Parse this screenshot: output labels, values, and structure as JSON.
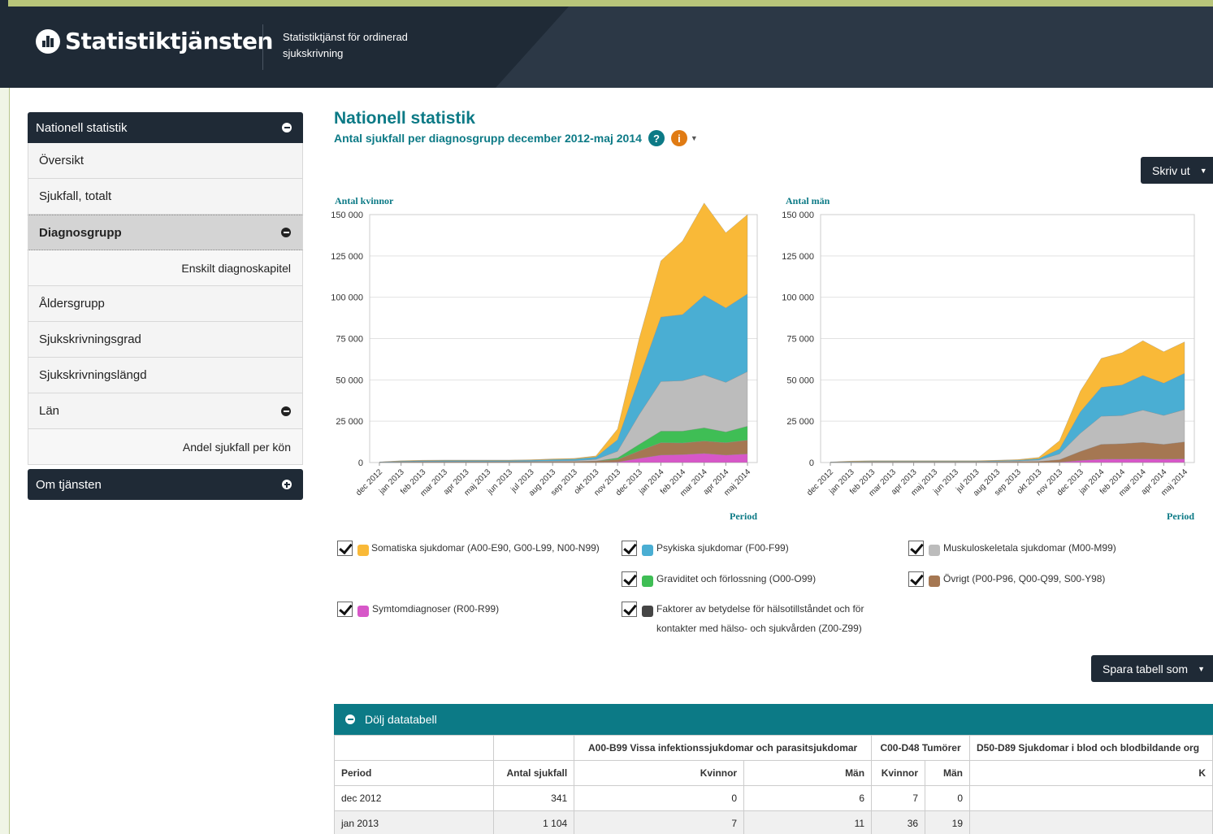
{
  "header": {
    "logo_text": "Statistiktjänsten",
    "subtitle": "Statistiktjänst för ordinerad sjukskrivning"
  },
  "sidebar": {
    "section_title": "Nationell statistik",
    "items": [
      {
        "label": "Översikt"
      },
      {
        "label": "Sjukfall, totalt"
      },
      {
        "label": "Diagnosgrupp"
      },
      {
        "label": "Enskilt diagnoskapitel"
      },
      {
        "label": "Åldersgrupp"
      },
      {
        "label": "Sjukskrivningsgrad"
      },
      {
        "label": "Sjukskrivningslängd"
      },
      {
        "label": "Län"
      },
      {
        "label": "Andel sjukfall per kön"
      }
    ],
    "about_title": "Om tjänsten"
  },
  "main": {
    "title": "Nationell statistik",
    "subtitle": "Antal sjukfall per diagnosgrupp december 2012-maj 2014",
    "print_label": "Skriv ut",
    "save_label": "Spara tabell som"
  },
  "legend": [
    {
      "label": "Somatiska sjukdomar (A00-E90, G00-L99, N00-N99)",
      "color": "#f9b938"
    },
    {
      "label": "Psykiska sjukdomar (F00-F99)",
      "color": "#4aaed3"
    },
    {
      "label": "Muskuloskeletala sjukdomar (M00-M99)",
      "color": "#bcbcbc"
    },
    {
      "label": "Graviditet och förlossning (O00-O99)",
      "color": "#3fbe55"
    },
    {
      "label": "Övrigt (P00-P96, Q00-Q99, S00-Y98)",
      "color": "#a57752"
    },
    {
      "label": "Symtomdiagnoser (R00-R99)",
      "color": "#d757c8"
    },
    {
      "label": "Faktorer av betydelse för hälsotillståndet och för kontakter med hälso- och sjukvården (Z00-Z99)",
      "color": "#454545"
    }
  ],
  "chart_data": [
    {
      "type": "area",
      "title": "Antal kvinnor",
      "xlabel": "Period",
      "ylim": [
        0,
        150000
      ],
      "yticks": [
        "0",
        "25 000",
        "50 000",
        "75 000",
        "100 000",
        "125 000",
        "150 000"
      ],
      "categories": [
        "dec 2012",
        "jan 2013",
        "feb 2013",
        "mar 2013",
        "apr 2013",
        "maj 2013",
        "jun 2013",
        "jul 2013",
        "aug 2013",
        "sep 2013",
        "okt 2013",
        "nov 2013",
        "dec 2013",
        "jan 2014",
        "feb 2014",
        "mar 2014",
        "apr 2014",
        "maj 2014"
      ],
      "series": [
        {
          "name": "Symtomdiagnoser (R00-R99)",
          "values": [
            0,
            0,
            0,
            0,
            0,
            0,
            0,
            0,
            0,
            0,
            0,
            300,
            2500,
            4500,
            4800,
            5500,
            4500,
            5200
          ]
        },
        {
          "name": "Övrigt (P00-P96, Q00-Q99, S00-Y98)",
          "values": [
            100,
            300,
            400,
            400,
            400,
            400,
            400,
            400,
            500,
            600,
            900,
            1500,
            4500,
            7500,
            7000,
            7500,
            7500,
            8300
          ]
        },
        {
          "name": "Graviditet och förlossning (O00-O99)",
          "values": [
            0,
            0,
            0,
            0,
            0,
            0,
            0,
            0,
            0,
            0,
            0,
            1000,
            4000,
            7000,
            7200,
            8000,
            6500,
            8500
          ]
        },
        {
          "name": "Muskuloskeletala sjukdomar (M00-M99)",
          "values": [
            50,
            100,
            200,
            200,
            200,
            200,
            200,
            300,
            400,
            500,
            1000,
            4000,
            18000,
            30000,
            30500,
            32000,
            30000,
            33000
          ]
        },
        {
          "name": "Psykiska sjukdomar (F00-F99)",
          "values": [
            150,
            400,
            500,
            600,
            600,
            600,
            600,
            700,
            900,
            1000,
            1400,
            7000,
            22000,
            39000,
            40000,
            48000,
            45000,
            47000
          ]
        },
        {
          "name": "Somatiska sjukdomar (A00-E90, G00-L99, N00-N99)",
          "values": [
            41,
            304,
            300,
            300,
            300,
            300,
            300,
            300,
            400,
            400,
            700,
            6500,
            24000,
            34000,
            44500,
            56000,
            45500,
            48000
          ]
        }
      ]
    },
    {
      "type": "area",
      "title": "Antal män",
      "xlabel": "Period",
      "ylim": [
        0,
        150000
      ],
      "yticks": [
        "0",
        "25 000",
        "50 000",
        "75 000",
        "100 000",
        "125 000",
        "150 000"
      ],
      "categories": [
        "dec 2012",
        "jan 2013",
        "feb 2013",
        "mar 2013",
        "apr 2013",
        "maj 2013",
        "jun 2013",
        "jul 2013",
        "aug 2013",
        "sep 2013",
        "okt 2013",
        "nov 2013",
        "dec 2013",
        "jan 2014",
        "feb 2014",
        "mar 2014",
        "apr 2014",
        "maj 2014"
      ],
      "series": [
        {
          "name": "Symtomdiagnoser (R00-R99)",
          "values": [
            0,
            0,
            0,
            0,
            0,
            0,
            0,
            0,
            0,
            0,
            0,
            200,
            1200,
            2000,
            2100,
            2200,
            2000,
            2200
          ]
        },
        {
          "name": "Övrigt (P00-P96, Q00-Q99, S00-Y98)",
          "values": [
            100,
            200,
            300,
            300,
            300,
            300,
            300,
            300,
            400,
            500,
            700,
            1500,
            5500,
            9000,
            9300,
            10000,
            9000,
            10300
          ]
        },
        {
          "name": "Muskuloskeletala sjukdomar (M00-M99)",
          "values": [
            50,
            150,
            200,
            200,
            200,
            200,
            200,
            200,
            300,
            400,
            800,
            3500,
            11000,
            17000,
            17000,
            19500,
            17500,
            19500
          ]
        },
        {
          "name": "Psykiska sjukdomar (F00-F99)",
          "values": [
            100,
            250,
            300,
            300,
            300,
            300,
            300,
            300,
            400,
            500,
            800,
            3000,
            13000,
            17500,
            18500,
            21000,
            19500,
            22000
          ]
        },
        {
          "name": "Somatiska sjukdomar (A00-E90, G00-L99, N00-N99)",
          "values": [
            50,
            300,
            300,
            300,
            300,
            300,
            300,
            300,
            300,
            400,
            800,
            5000,
            12500,
            17500,
            19500,
            21000,
            19000,
            19000
          ]
        }
      ]
    }
  ],
  "table": {
    "toggle_label": "Dölj datatabell",
    "group_headers": [
      "",
      "",
      "A00-B99 Vissa infektionssjukdomar och parasitsjukdomar",
      "C00-D48 Tumörer",
      "D50-D89 Sjukdomar i blod och blodbildande org"
    ],
    "columns": [
      "Period",
      "Antal sjukfall",
      "Kvinnor",
      "Män",
      "Kvinnor",
      "Män",
      "K"
    ],
    "rows": [
      [
        "dec 2012",
        "341",
        "0",
        "6",
        "7",
        "0",
        ""
      ],
      [
        "jan 2013",
        "1 104",
        "7",
        "11",
        "36",
        "19",
        ""
      ]
    ]
  }
}
